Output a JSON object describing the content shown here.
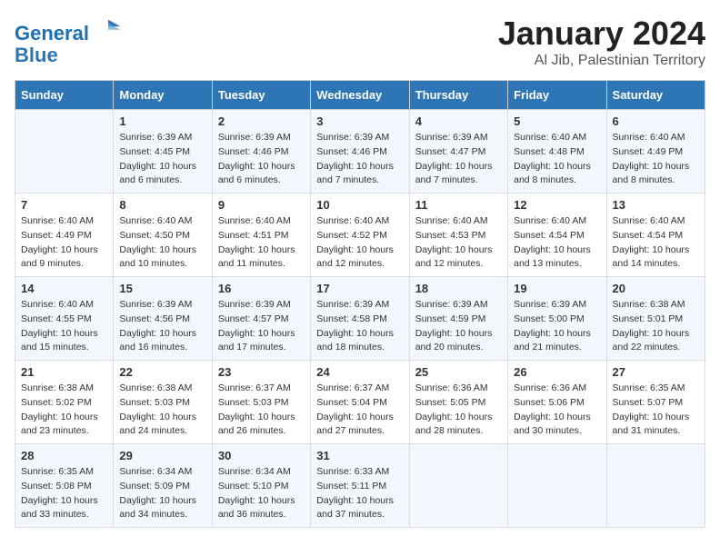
{
  "header": {
    "logo_line1": "General",
    "logo_line2": "Blue",
    "month": "January 2024",
    "location": "Al Jib, Palestinian Territory"
  },
  "days_of_week": [
    "Sunday",
    "Monday",
    "Tuesday",
    "Wednesday",
    "Thursday",
    "Friday",
    "Saturday"
  ],
  "weeks": [
    [
      {
        "day": "",
        "sunrise": "",
        "sunset": "",
        "daylight": ""
      },
      {
        "day": "1",
        "sunrise": "Sunrise: 6:39 AM",
        "sunset": "Sunset: 4:45 PM",
        "daylight": "Daylight: 10 hours and 6 minutes."
      },
      {
        "day": "2",
        "sunrise": "Sunrise: 6:39 AM",
        "sunset": "Sunset: 4:46 PM",
        "daylight": "Daylight: 10 hours and 6 minutes."
      },
      {
        "day": "3",
        "sunrise": "Sunrise: 6:39 AM",
        "sunset": "Sunset: 4:46 PM",
        "daylight": "Daylight: 10 hours and 7 minutes."
      },
      {
        "day": "4",
        "sunrise": "Sunrise: 6:39 AM",
        "sunset": "Sunset: 4:47 PM",
        "daylight": "Daylight: 10 hours and 7 minutes."
      },
      {
        "day": "5",
        "sunrise": "Sunrise: 6:40 AM",
        "sunset": "Sunset: 4:48 PM",
        "daylight": "Daylight: 10 hours and 8 minutes."
      },
      {
        "day": "6",
        "sunrise": "Sunrise: 6:40 AM",
        "sunset": "Sunset: 4:49 PM",
        "daylight": "Daylight: 10 hours and 8 minutes."
      }
    ],
    [
      {
        "day": "7",
        "sunrise": "Sunrise: 6:40 AM",
        "sunset": "Sunset: 4:49 PM",
        "daylight": "Daylight: 10 hours and 9 minutes."
      },
      {
        "day": "8",
        "sunrise": "Sunrise: 6:40 AM",
        "sunset": "Sunset: 4:50 PM",
        "daylight": "Daylight: 10 hours and 10 minutes."
      },
      {
        "day": "9",
        "sunrise": "Sunrise: 6:40 AM",
        "sunset": "Sunset: 4:51 PM",
        "daylight": "Daylight: 10 hours and 11 minutes."
      },
      {
        "day": "10",
        "sunrise": "Sunrise: 6:40 AM",
        "sunset": "Sunset: 4:52 PM",
        "daylight": "Daylight: 10 hours and 12 minutes."
      },
      {
        "day": "11",
        "sunrise": "Sunrise: 6:40 AM",
        "sunset": "Sunset: 4:53 PM",
        "daylight": "Daylight: 10 hours and 12 minutes."
      },
      {
        "day": "12",
        "sunrise": "Sunrise: 6:40 AM",
        "sunset": "Sunset: 4:54 PM",
        "daylight": "Daylight: 10 hours and 13 minutes."
      },
      {
        "day": "13",
        "sunrise": "Sunrise: 6:40 AM",
        "sunset": "Sunset: 4:54 PM",
        "daylight": "Daylight: 10 hours and 14 minutes."
      }
    ],
    [
      {
        "day": "14",
        "sunrise": "Sunrise: 6:40 AM",
        "sunset": "Sunset: 4:55 PM",
        "daylight": "Daylight: 10 hours and 15 minutes."
      },
      {
        "day": "15",
        "sunrise": "Sunrise: 6:39 AM",
        "sunset": "Sunset: 4:56 PM",
        "daylight": "Daylight: 10 hours and 16 minutes."
      },
      {
        "day": "16",
        "sunrise": "Sunrise: 6:39 AM",
        "sunset": "Sunset: 4:57 PM",
        "daylight": "Daylight: 10 hours and 17 minutes."
      },
      {
        "day": "17",
        "sunrise": "Sunrise: 6:39 AM",
        "sunset": "Sunset: 4:58 PM",
        "daylight": "Daylight: 10 hours and 18 minutes."
      },
      {
        "day": "18",
        "sunrise": "Sunrise: 6:39 AM",
        "sunset": "Sunset: 4:59 PM",
        "daylight": "Daylight: 10 hours and 20 minutes."
      },
      {
        "day": "19",
        "sunrise": "Sunrise: 6:39 AM",
        "sunset": "Sunset: 5:00 PM",
        "daylight": "Daylight: 10 hours and 21 minutes."
      },
      {
        "day": "20",
        "sunrise": "Sunrise: 6:38 AM",
        "sunset": "Sunset: 5:01 PM",
        "daylight": "Daylight: 10 hours and 22 minutes."
      }
    ],
    [
      {
        "day": "21",
        "sunrise": "Sunrise: 6:38 AM",
        "sunset": "Sunset: 5:02 PM",
        "daylight": "Daylight: 10 hours and 23 minutes."
      },
      {
        "day": "22",
        "sunrise": "Sunrise: 6:38 AM",
        "sunset": "Sunset: 5:03 PM",
        "daylight": "Daylight: 10 hours and 24 minutes."
      },
      {
        "day": "23",
        "sunrise": "Sunrise: 6:37 AM",
        "sunset": "Sunset: 5:03 PM",
        "daylight": "Daylight: 10 hours and 26 minutes."
      },
      {
        "day": "24",
        "sunrise": "Sunrise: 6:37 AM",
        "sunset": "Sunset: 5:04 PM",
        "daylight": "Daylight: 10 hours and 27 minutes."
      },
      {
        "day": "25",
        "sunrise": "Sunrise: 6:36 AM",
        "sunset": "Sunset: 5:05 PM",
        "daylight": "Daylight: 10 hours and 28 minutes."
      },
      {
        "day": "26",
        "sunrise": "Sunrise: 6:36 AM",
        "sunset": "Sunset: 5:06 PM",
        "daylight": "Daylight: 10 hours and 30 minutes."
      },
      {
        "day": "27",
        "sunrise": "Sunrise: 6:35 AM",
        "sunset": "Sunset: 5:07 PM",
        "daylight": "Daylight: 10 hours and 31 minutes."
      }
    ],
    [
      {
        "day": "28",
        "sunrise": "Sunrise: 6:35 AM",
        "sunset": "Sunset: 5:08 PM",
        "daylight": "Daylight: 10 hours and 33 minutes."
      },
      {
        "day": "29",
        "sunrise": "Sunrise: 6:34 AM",
        "sunset": "Sunset: 5:09 PM",
        "daylight": "Daylight: 10 hours and 34 minutes."
      },
      {
        "day": "30",
        "sunrise": "Sunrise: 6:34 AM",
        "sunset": "Sunset: 5:10 PM",
        "daylight": "Daylight: 10 hours and 36 minutes."
      },
      {
        "day": "31",
        "sunrise": "Sunrise: 6:33 AM",
        "sunset": "Sunset: 5:11 PM",
        "daylight": "Daylight: 10 hours and 37 minutes."
      },
      {
        "day": "",
        "sunrise": "",
        "sunset": "",
        "daylight": ""
      },
      {
        "day": "",
        "sunrise": "",
        "sunset": "",
        "daylight": ""
      },
      {
        "day": "",
        "sunrise": "",
        "sunset": "",
        "daylight": ""
      }
    ]
  ]
}
